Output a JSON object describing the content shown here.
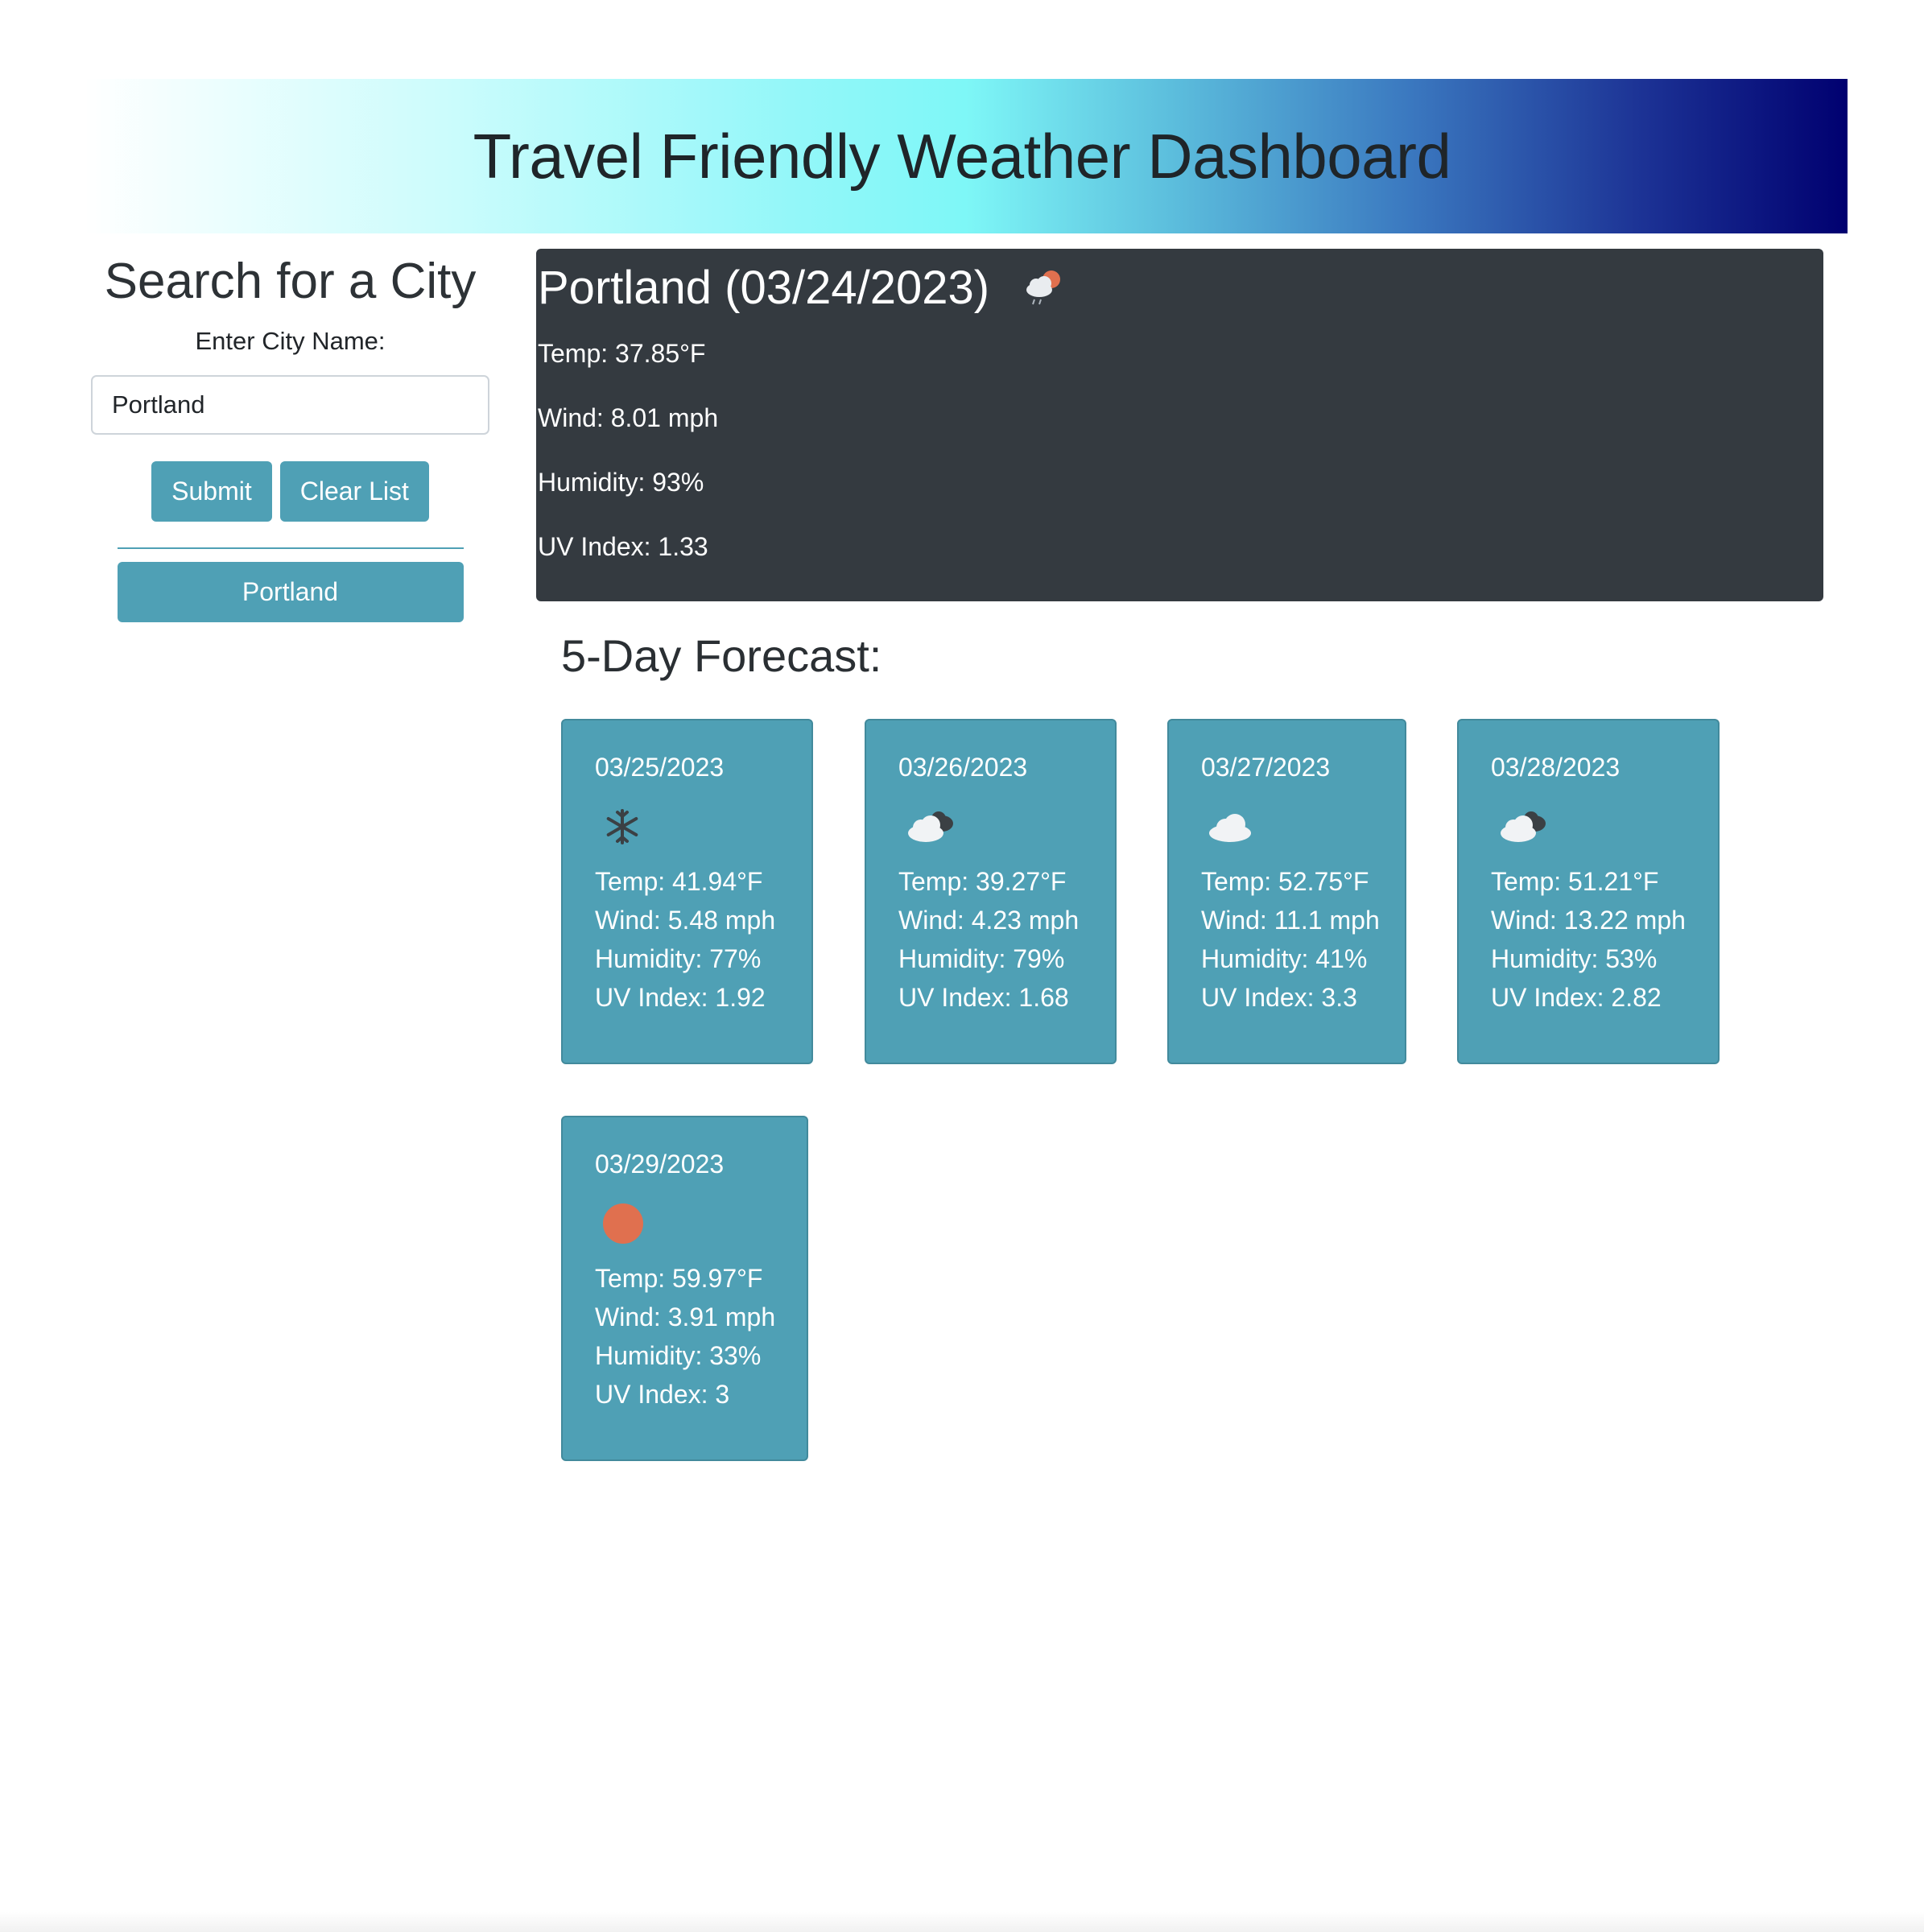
{
  "header": {
    "title": "Travel Friendly Weather Dashboard",
    "gradient_colors": [
      "#ffffff",
      "#7ef7f7",
      "#000070"
    ]
  },
  "sidebar": {
    "title": "Search for a City",
    "input_label": "Enter City Name:",
    "input_value": "Portland",
    "submit_label": "Submit",
    "clear_label": "Clear List",
    "history": [
      "Portland"
    ]
  },
  "current": {
    "title": "Portland (03/24/2023)",
    "icon": "cloud-sun-rain-icon",
    "temp": "Temp: 37.85°F",
    "wind": "Wind: 8.01 mph",
    "humidity": "Humidity: 93%",
    "uv": "UV Index: 1.33"
  },
  "forecast": {
    "heading": "5-Day Forecast:",
    "days": [
      {
        "date": "03/25/2023",
        "icon": "snowflake-icon",
        "temp": "Temp: 41.94°F",
        "wind": "Wind: 5.48 mph",
        "humidity": "Humidity: 77%",
        "uv": "UV Index: 1.92"
      },
      {
        "date": "03/26/2023",
        "icon": "broken-clouds-icon",
        "temp": "Temp: 39.27°F",
        "wind": "Wind: 4.23 mph",
        "humidity": "Humidity: 79%",
        "uv": "UV Index: 1.68"
      },
      {
        "date": "03/27/2023",
        "icon": "cloud-icon",
        "temp": "Temp: 52.75°F",
        "wind": "Wind: 11.1 mph",
        "humidity": "Humidity: 41%",
        "uv": "UV Index: 3.3"
      },
      {
        "date": "03/28/2023",
        "icon": "broken-clouds-icon",
        "temp": "Temp: 51.21°F",
        "wind": "Wind: 13.22 mph",
        "humidity": "Humidity: 53%",
        "uv": "UV Index: 2.82"
      },
      {
        "date": "03/29/2023",
        "icon": "sun-icon",
        "temp": "Temp: 59.97°F",
        "wind": "Wind: 3.91 mph",
        "humidity": "Humidity: 33%",
        "uv": "UV Index: 3"
      }
    ]
  },
  "colors": {
    "accent": "#4fa0b5",
    "panel": "#343a40",
    "sun": "#e0704f"
  }
}
